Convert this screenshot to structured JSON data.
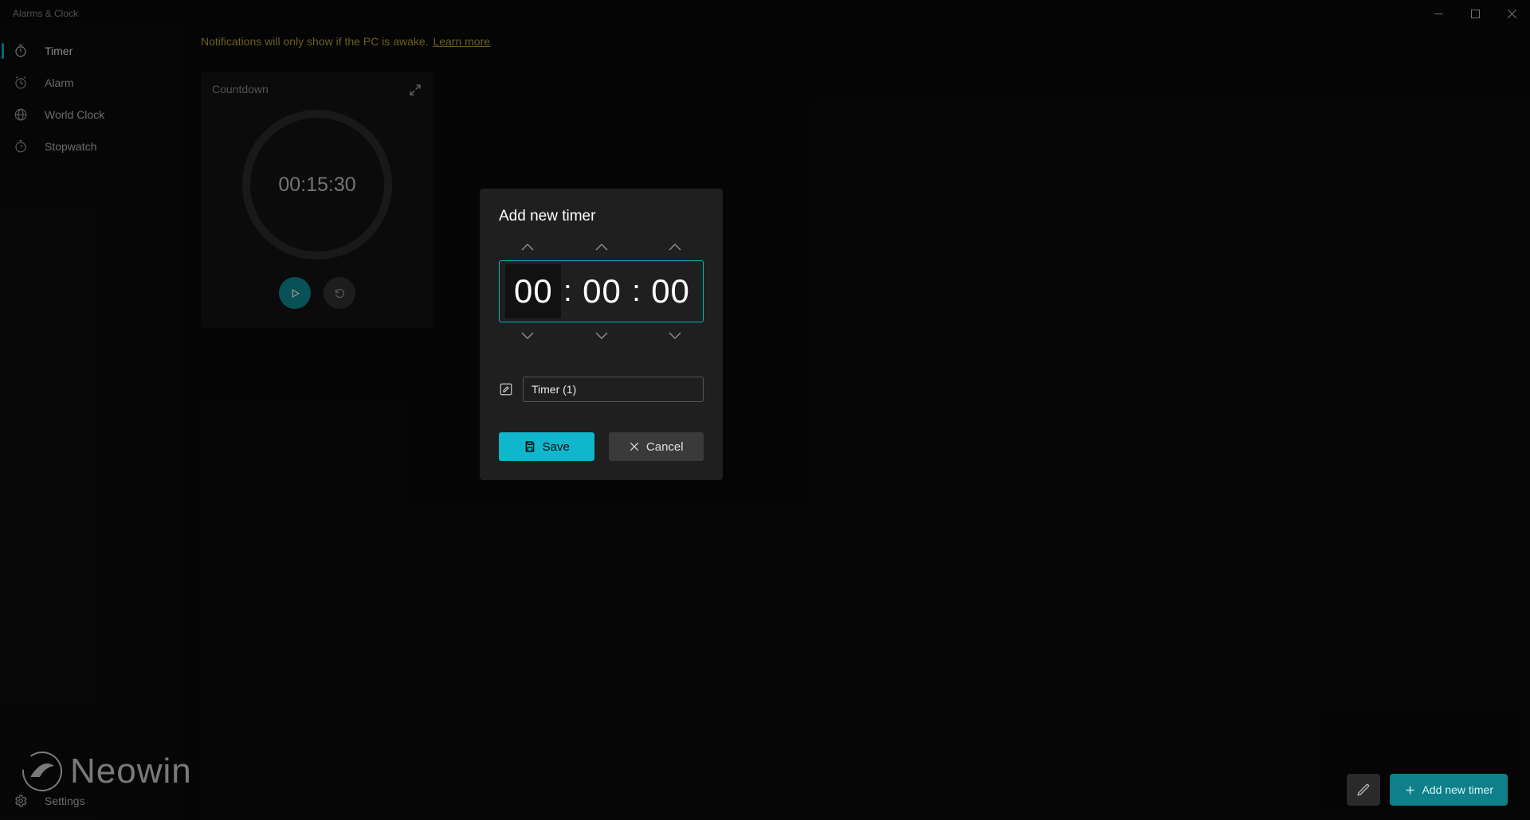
{
  "app": {
    "title": "Alarms & Clock"
  },
  "sidebar": {
    "items": [
      {
        "label": "Timer",
        "active": true
      },
      {
        "label": "Alarm"
      },
      {
        "label": "World Clock"
      },
      {
        "label": "Stopwatch"
      }
    ],
    "settings_label": "Settings"
  },
  "notification": {
    "text": "Notifications will only show if the PC is awake.",
    "link_label": "Learn more"
  },
  "timer_card": {
    "title": "Countdown",
    "time": "00:15:30"
  },
  "dialog": {
    "title": "Add new timer",
    "hours": "00",
    "minutes": "00",
    "seconds": "00",
    "name_value": "Timer (1)",
    "save_label": "Save",
    "cancel_label": "Cancel"
  },
  "bottom": {
    "add_label": "Add new timer"
  },
  "watermark": {
    "text": "Neowin"
  }
}
